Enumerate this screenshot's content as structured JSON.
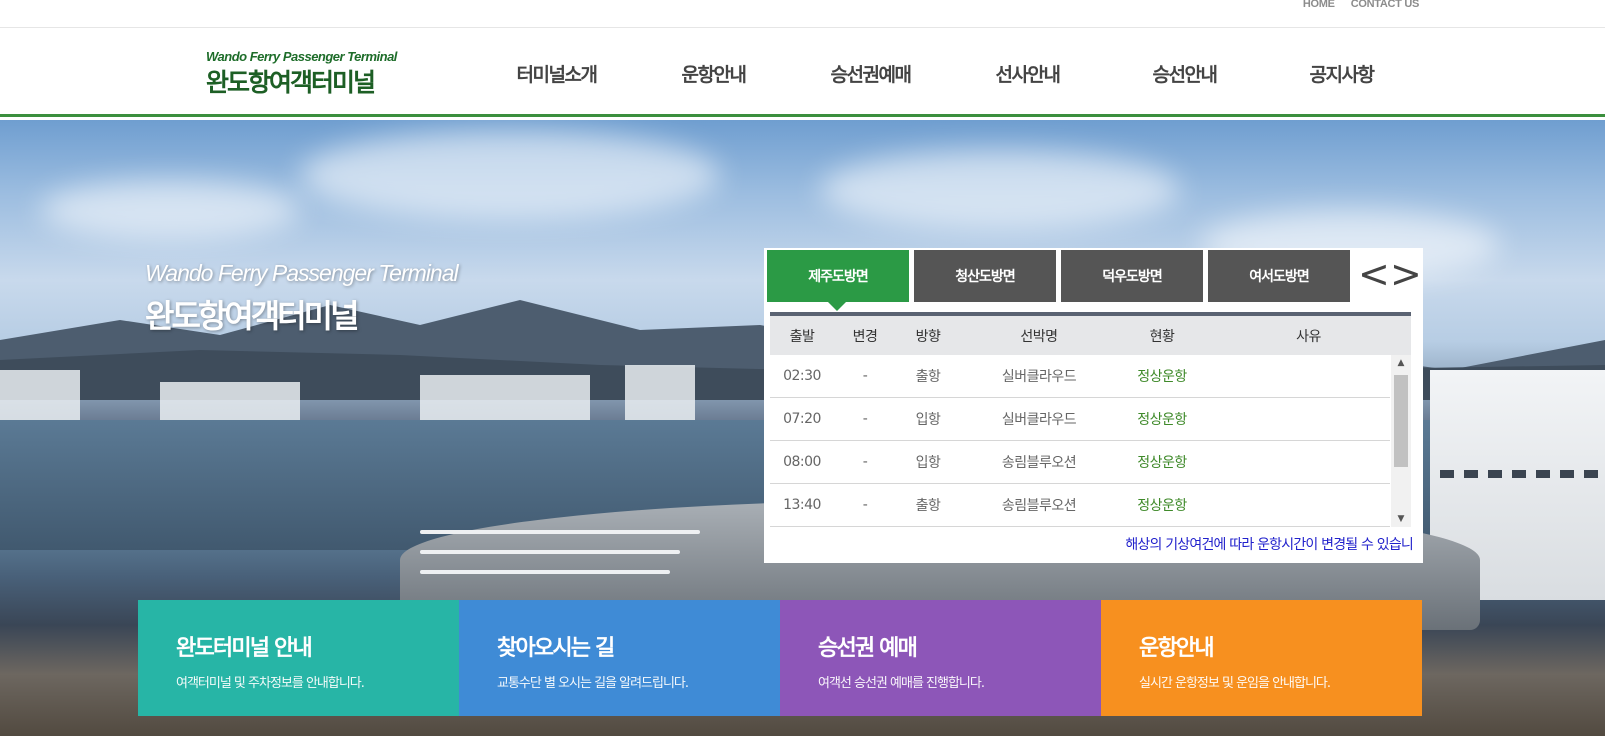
{
  "util_links": [
    "HOME",
    "CONTACT US"
  ],
  "logo": {
    "en": "Wando Ferry Passenger Terminal",
    "ko": "완도항여객터미널"
  },
  "nav": [
    "터미널소개",
    "운항안내",
    "승선권예매",
    "선사안내",
    "승선안내",
    "공지사항"
  ],
  "hero": {
    "en": "Wando Ferry Passenger Terminal",
    "ko": "완도항여객터미널"
  },
  "schedule": {
    "tabs": [
      "제주도방면",
      "청산도방면",
      "덕우도방면",
      "여서도방면"
    ],
    "active_tab": 0,
    "prev": "<",
    "next": ">",
    "headers": [
      "출발",
      "변경",
      "방향",
      "선박명",
      "현황",
      "사유"
    ],
    "rows": [
      [
        "02:30",
        "-",
        "출항",
        "실버클라우드",
        "정상운항",
        ""
      ],
      [
        "07:20",
        "-",
        "입항",
        "실버클라우드",
        "정상운항",
        ""
      ],
      [
        "08:00",
        "-",
        "입항",
        "송림블루오션",
        "정상운항",
        ""
      ],
      [
        "13:40",
        "-",
        "출항",
        "송림블루오션",
        "정상운항",
        ""
      ]
    ],
    "notice": "해상의 기상여건에 따라 운항시간이 변경될 수 있습니"
  },
  "quick": [
    {
      "title": "완도터미널 안내",
      "desc": "여객터미널 및 주차정보를 안내합니다."
    },
    {
      "title": "찾아오시는 길",
      "desc": "교통수단 별 오시는 길을 알려드립니다."
    },
    {
      "title": "승선권 예매",
      "desc": "여객선 승선권 예매를 진행합니다."
    },
    {
      "title": "운항안내",
      "desc": "실시간 운항정보 및 운임을 안내합니다."
    }
  ],
  "colors": {
    "brand_green": "#2b9a45",
    "status_green": "#3f8a2a",
    "notice_blue": "#2222cc"
  }
}
